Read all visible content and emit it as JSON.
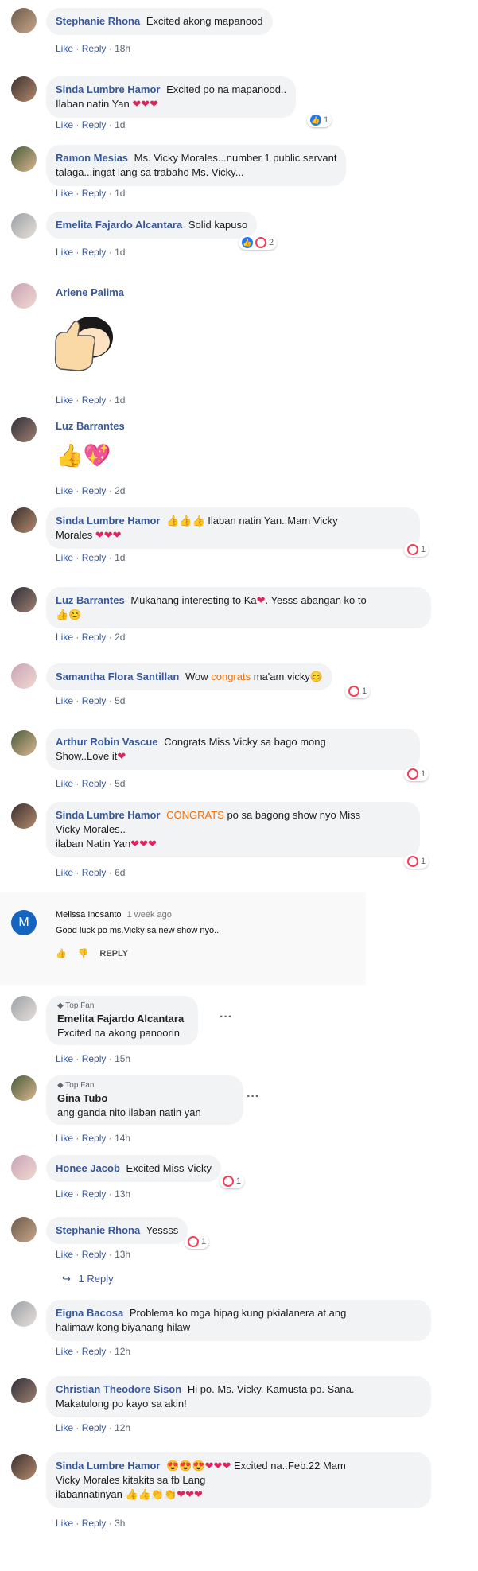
{
  "comments": [
    {
      "name": "Stephanie Rhona",
      "text": "Excited akong mapanood",
      "time": "18h"
    },
    {
      "name": "Sinda Lumbre Hamor",
      "text": "Excited po na mapanood..",
      "text2": "Ilaban natin Yan",
      "time": "1d",
      "react_count": "1"
    },
    {
      "name": "Ramon Mesias",
      "text": "Ms. Vicky Morales...number 1 public servant",
      "text2": "talaga...ingat lang sa trabaho Ms. Vicky...",
      "time": "1d"
    },
    {
      "name": "Emelita Fajardo Alcantara",
      "text": "Solid kapuso",
      "time": "1d",
      "react_count": "2"
    },
    {
      "name": "Arlene Palima",
      "time": "1d"
    },
    {
      "name": "Luz Barrantes",
      "time": "2d"
    },
    {
      "name": "Sinda Lumbre Hamor",
      "text": "Ilaban natin Yan..Mam Vicky",
      "text2": "Morales",
      "time": "1d",
      "react_count": "1"
    },
    {
      "name": "Luz Barrantes",
      "text": "Mukahang interesting to Ka",
      "text_b": ". Yesss abangan ko to",
      "time": "2d"
    },
    {
      "name": "Samantha Flora Santillan",
      "text": "Wow",
      "text_orange": "congrats",
      "text_c": "ma'am vicky",
      "time": "5d",
      "react_count": "1"
    },
    {
      "name": "Arthur Robin Vascue",
      "text": "Congrats Miss Vicky sa bago mong",
      "text2": "Show..Love it",
      "time": "5d",
      "react_count": "1"
    },
    {
      "name": "Sinda Lumbre Hamor",
      "text_orange": "CONGRATS",
      "text": "po sa bagong show nyo Miss",
      "text2": "Vicky Morales..",
      "text3": "ilaban Natin Yan",
      "time": "6d",
      "react_count": "1"
    }
  ],
  "actions": {
    "like": "Like",
    "reply": "Reply",
    "sep": "·"
  },
  "youtube": {
    "avatar_letter": "M",
    "name": "Melissa Inosanto",
    "time": "1 week ago",
    "text": "Good luck po ms.Vicky sa new show nyo..",
    "reply": "REPLY"
  },
  "comments2": [
    {
      "badge": "Top Fan",
      "name": "Emelita Fajardo Alcantara",
      "text": "Excited na akong panoorin",
      "time": "15h"
    },
    {
      "badge": "Top Fan",
      "name": "Gina Tubo",
      "text": "ang ganda nito ilaban natin yan",
      "time": "14h"
    },
    {
      "name": "Honee Jacob",
      "text": "Excited Miss Vicky",
      "time": "13h",
      "react_count": "1"
    },
    {
      "name": "Stephanie Rhona",
      "text": "Yessss",
      "time": "13h",
      "react_count": "1"
    },
    {
      "name": "Eigna Bacosa",
      "text": "Problema ko mga hipag kung pkialanera at ang",
      "text2": "halimaw kong biyanang hilaw",
      "time": "12h"
    },
    {
      "name": "Christian Theodore Sison",
      "text": "Hi po. Ms. Vicky. Kamusta po. Sana.",
      "text2": "Makatulong po kayo sa akin!",
      "time": "12h"
    },
    {
      "name": "Sinda Lumbre Hamor",
      "text": "Excited na..Feb.22 Mam",
      "text2": "Vicky Morales kitakits sa fb Lang",
      "text3": "ilabannatinyan",
      "time": "3h"
    }
  ],
  "replies_link": "1 Reply",
  "icons": {
    "like": "thumbs-up-icon",
    "love": "heart-icon",
    "dots": "more-dots-icon",
    "reply_arrow": "reply-arrow-icon"
  }
}
